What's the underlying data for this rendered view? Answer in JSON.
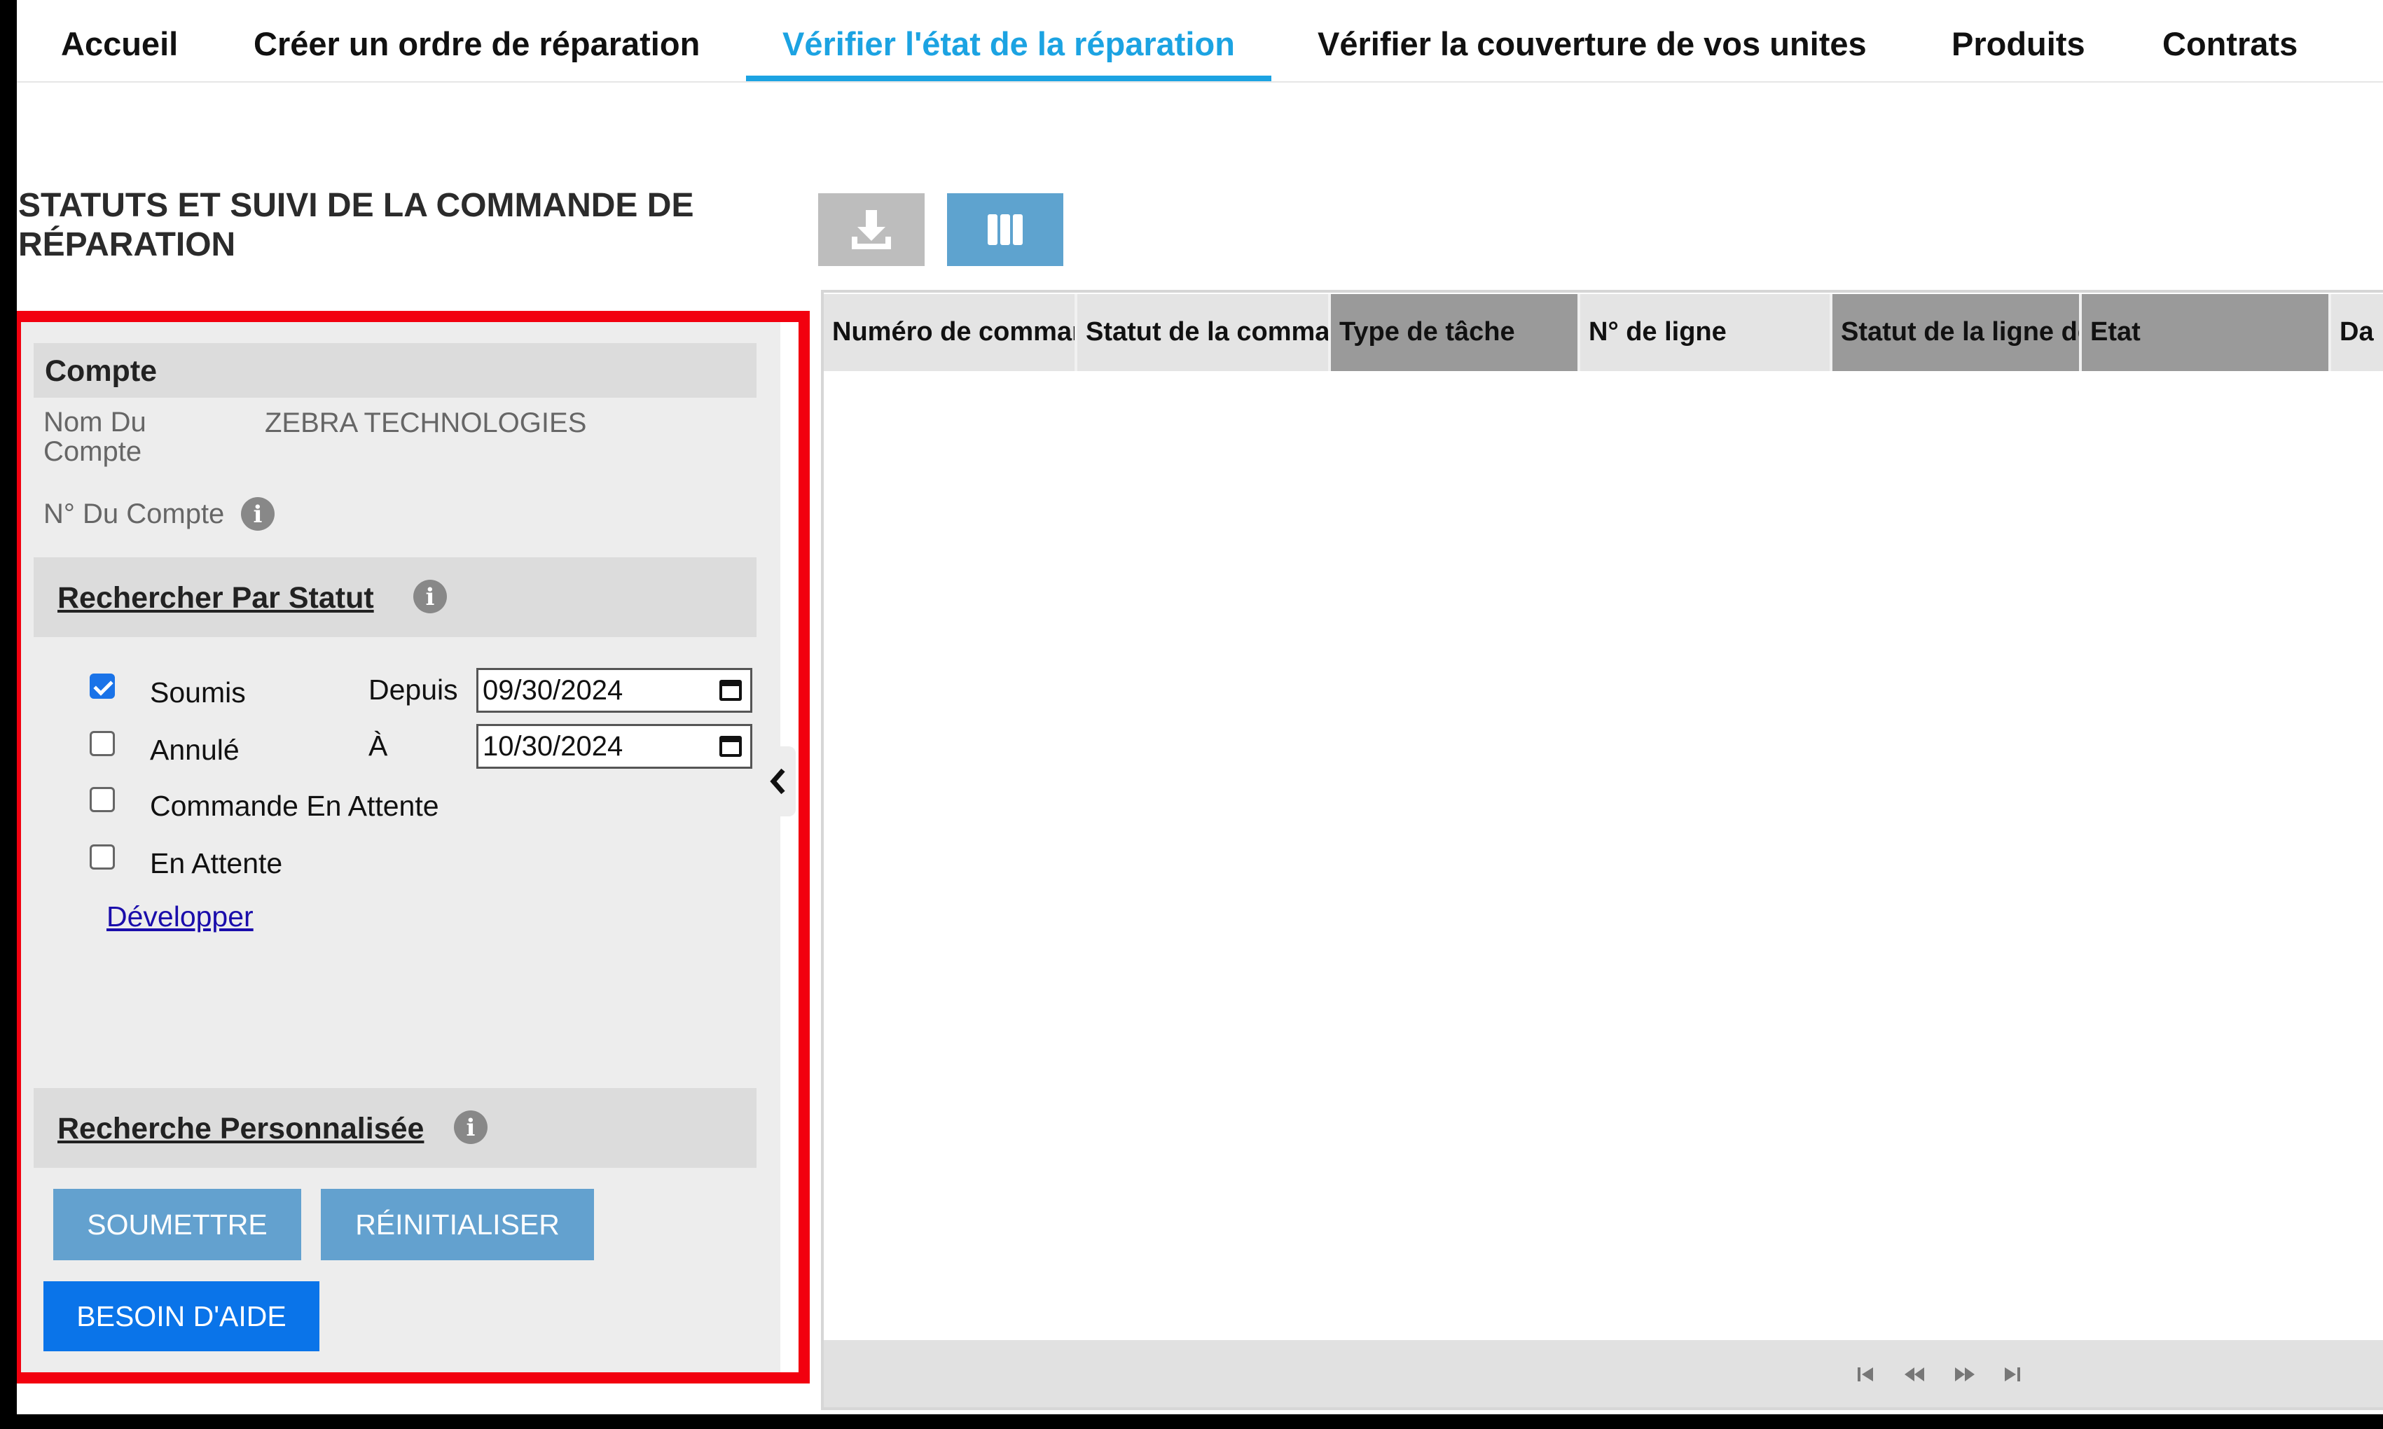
{
  "nav": {
    "tabs": [
      {
        "label": "Accueil"
      },
      {
        "label": "Créer un ordre de réparation"
      },
      {
        "label": "Vérifier l'état de la réparation"
      },
      {
        "label": "Vérifier la couverture de vos unites"
      },
      {
        "label": "Produits"
      },
      {
        "label": "Contrats"
      }
    ],
    "active_index": 2
  },
  "page_title": "STATUTS ET SUIVI DE LA COMMANDE DE RÉPARATION",
  "account": {
    "heading": "Compte",
    "name_label": "Nom Du Compte",
    "name_value": "ZEBRA TECHNOLOGIES",
    "number_label": "N° Du Compte"
  },
  "status_search": {
    "heading": "Rechercher Par Statut",
    "statuses": [
      {
        "label": "Soumis",
        "checked": true
      },
      {
        "label": "Annulé",
        "checked": false
      },
      {
        "label": "Commande En Attente",
        "checked": false
      },
      {
        "label": "En Attente",
        "checked": false
      }
    ],
    "from_label": "Depuis",
    "from_value": "09/30/2024",
    "to_label": "À",
    "to_value": "10/30/2024",
    "expand_link": "Développer"
  },
  "custom_search": {
    "heading": "Recherche Personnalisée"
  },
  "buttons": {
    "submit": "SOUMETTRE",
    "reset": "RÉINITIALISER",
    "help": "BESOIN D'AIDE"
  },
  "toolbar": {
    "download_icon": "download-icon",
    "columns_icon": "columns-icon"
  },
  "table": {
    "columns": [
      "Numéro de commande",
      "Statut de la commande",
      "Type de tâche",
      "N° de ligne",
      "Statut de la ligne de",
      "Etat",
      "Da"
    ],
    "rows": []
  },
  "pager": {
    "icons": [
      "first-page-icon",
      "previous-page-icon",
      "next-page-icon",
      "last-page-icon"
    ]
  },
  "colors": {
    "accent": "#1ca3e2",
    "highlight_border": "#f2000f",
    "button": "#63a1cf",
    "help_button": "#0a74e9",
    "header_dark": "#9a9a9a",
    "header_light": "#e4e4e4"
  }
}
